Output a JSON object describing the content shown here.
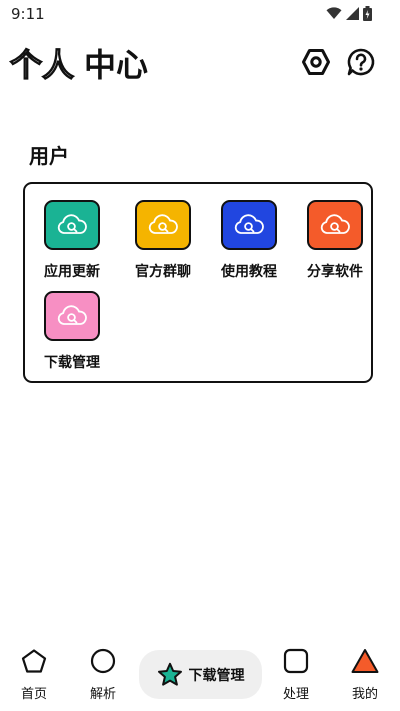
{
  "status_bar": {
    "time": "9:11",
    "icons": [
      "wifi-icon",
      "signal-icon",
      "battery-icon"
    ]
  },
  "header": {
    "title_outline": "个人",
    "title_bold": "中心",
    "buttons": [
      "settings-hexagon-icon",
      "help-question-icon"
    ]
  },
  "section": {
    "title": "用户"
  },
  "grid": {
    "items": [
      {
        "label": "应用更新",
        "color": "#1ab394",
        "icon": "cloud-search-icon"
      },
      {
        "label": "官方群聊",
        "color": "#f5b400",
        "icon": "cloud-search-icon"
      },
      {
        "label": "使用教程",
        "color": "#2146e0",
        "icon": "cloud-search-icon"
      },
      {
        "label": "分享软件",
        "color": "#f45b2a",
        "icon": "cloud-search-icon"
      },
      {
        "label": "下载管理",
        "color": "#f78fc3",
        "icon": "cloud-search-icon"
      }
    ]
  },
  "bottom_nav": {
    "home": {
      "label": "首页",
      "icon": "pentagon-icon"
    },
    "parse": {
      "label": "解析",
      "icon": "circle-icon"
    },
    "center": {
      "label": "下载管理",
      "icon": "star-icon",
      "star_color": "#1ab394"
    },
    "process": {
      "label": "处理",
      "icon": "rounded-square-icon"
    },
    "mine": {
      "label": "我的",
      "icon": "triangle-icon",
      "triangle_color": "#f45b2a"
    }
  }
}
